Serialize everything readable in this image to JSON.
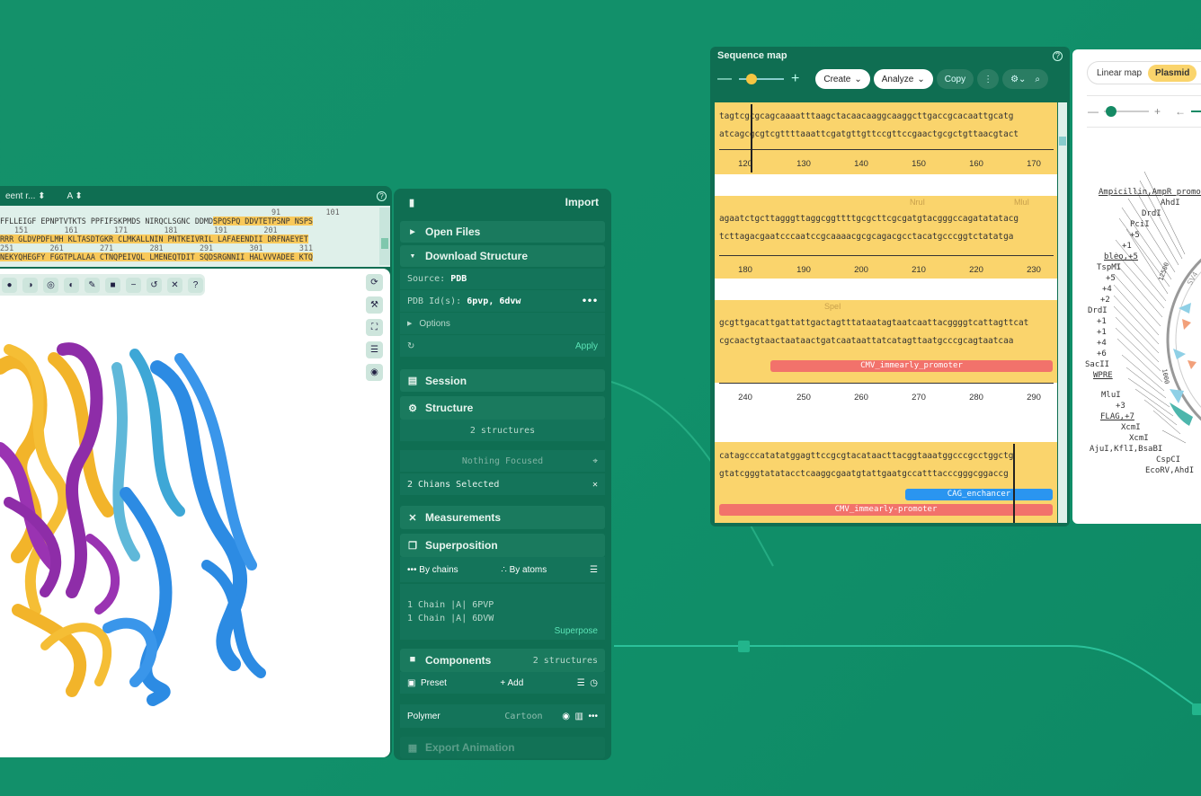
{
  "molecule_viewer": {
    "model_dropdown": "eent r...",
    "chain_dropdown": "A",
    "help": "?",
    "sequence_numbers_1": [
      "91",
      "101"
    ],
    "sequence_line_1a": "FFLLEIGF EPNPTVTKTS PPFIFSKPMDS NIRQCLSGNC DDMD",
    "sequence_line_1b": "SPQSPQ DDVTETPSNP NSPS",
    "sequence_numbers_2": [
      "151",
      "161",
      "171",
      "181",
      "191",
      "201"
    ],
    "sequence_line_2": "RRR GLDVPDFLMH KLTASDTGKR CLMKALLNIN PNTKEIVRIL LAFAEENDII DRFNAEYET",
    "sequence_numbers_3": [
      "251",
      "261",
      "271",
      "281",
      "291",
      "301",
      "311"
    ],
    "sequence_line_3": "NEKYQHEGFY FGGTPLALAA CTNQPEIVQL LMENEQTDIT SQDSRGNNII HALVVVADEE KTQ"
  },
  "import_panel": {
    "title": "Import",
    "open_files": "Open Files",
    "download_structure": "Download Structure",
    "source_label": "Source:",
    "source_value": "PDB",
    "pdb_ids_label": "PDB Id(s):",
    "pdb_ids_value": "6pvp, 6dvw",
    "more": "•••",
    "options": "Options",
    "apply": "Apply",
    "session": "Session",
    "structure": "Structure",
    "structure_count": "2 structures",
    "nothing_focused": "Nothing Focused",
    "chains_selected": "2 Chians Selected",
    "measurements": "Measurements",
    "superposition": "Superposition",
    "by_chains": "By chains",
    "by_atoms": "By atoms",
    "chain_1": "1 Chain |A| 6PVP",
    "chain_2": "1 Chain |A| 6DVW",
    "superpose": "Superpose",
    "components": "Components",
    "components_count": "2 structures",
    "preset": "Preset",
    "add": "+ Add",
    "polymer": "Polymer",
    "cartoon": "Cartoon",
    "export_animation": "Export Animation"
  },
  "sequence_map": {
    "title": "Sequence map",
    "create": "Create",
    "analyze": "Analyze",
    "copy": "Copy",
    "help": "?",
    "block1": {
      "top": "tagtcgcgcagcaaaatttaagctacaacaaggcaaggcttgaccgcacaattgcatg",
      "bottom": "atcagcgcgtcgttttaaattcgatgttgttccgttccgaactgcgctgttaacgtact",
      "ticks": [
        "120",
        "130",
        "140",
        "150",
        "160",
        "170"
      ]
    },
    "block2": {
      "enzymes": [
        "NruI",
        "MluI"
      ],
      "top": "agaatctgcttagggttaggcggttttgcgcttcgcgatgtacgggccagatatatacg",
      "bottom": "tcttagacgaatcccaatccgcaaaacgcgcagacgcctacatgcccggtctatatga",
      "ticks": [
        "180",
        "190",
        "200",
        "210",
        "220",
        "230"
      ]
    },
    "block3": {
      "enzymes": [
        "SpeI"
      ],
      "top": "gcgttgacattgattattgactagtttataatagtaatcaattacggggtcattagttcat",
      "bottom": "cgcaactgtaactaataactgatcaataattatcatagttaatgcccgcagtaatcaa",
      "feature": "CMV_immearly_promoter",
      "ticks": [
        "240",
        "250",
        "260",
        "270",
        "280",
        "290"
      ]
    },
    "block4": {
      "top": "catagcccatatatggagttccgcgtacataacttacggtaaatggcccgcctggctg",
      "bottom": "gtatcgggtatatacctcaaggcgaatgtattgaatgccatttacccgggcggaccg",
      "feature_1": "CAG_enchancer",
      "feature_2": "CMV_immearly-promoter"
    }
  },
  "plasmid": {
    "linear_map": "Linear map",
    "plasmid_tab": "Plasmid",
    "labels": [
      "Ampicillin,AmpR_promot",
      "AhdI",
      "DrdI",
      "PciI",
      "+5",
      "+1",
      "bleo,+5",
      "TspMI",
      "+5",
      "+4",
      "+2",
      "DrdI",
      "+1",
      "+1",
      "+4",
      "+6",
      "SacII",
      "WPRE",
      "MluI",
      "+3",
      "FLAG,+7",
      "XcmI",
      "XcmI",
      "AjuI,KflI,BsaBI",
      "CspCI",
      "EcoRV,AhdI"
    ],
    "ring_text_1": "12500",
    "ring_text_2": "1000",
    "ring_text_3": "SV4"
  },
  "colors": {
    "background": "#12906a",
    "panel": "#0f6e52",
    "highlight": "#fad46c",
    "feature_red": "#f2726b",
    "feature_blue": "#2a95f0",
    "accent_green": "#5be3b6"
  }
}
